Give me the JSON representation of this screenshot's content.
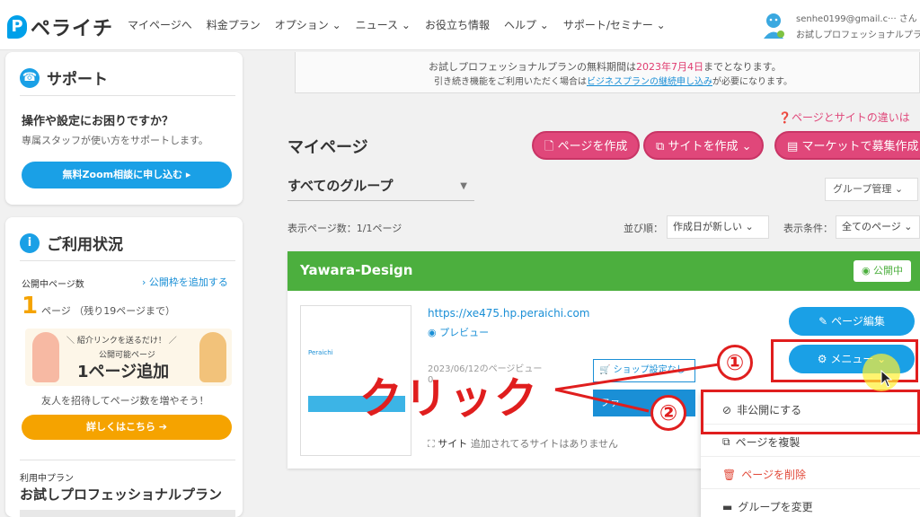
{
  "header": {
    "logo_text": "ペライチ",
    "nav": [
      "マイページへ",
      "料金プラン",
      "オプション ⌄",
      "ニュース ⌄",
      "お役立ち情報",
      "ヘルプ ⌄",
      "サポート/セミナー ⌄"
    ],
    "user_email": "senhe0199@gmail.c··· さん",
    "user_plan": "お試しプロフェッショナルプラン"
  },
  "sidebar": {
    "support": {
      "title": "サポート",
      "question": "操作や設定にお困りですか？",
      "description": "専属スタッフが使い方をサポートします。",
      "button": "無料Zoom相談に申し込む ▸"
    },
    "usage": {
      "title": "ご利用状況",
      "published_label": "公開中ページ数",
      "add_slot_link": "› 公開枠を追加する",
      "published_count": "1",
      "published_count_text": "ページ （残り19ページまで）",
      "promo_top": "＼ 紹介リンクを送るだけ！ ／",
      "promo_mid": "公開可能ページ",
      "promo_big": "1ページ追加",
      "invite_text": "友人を招待してページ数を増やそう！",
      "details_button": "詳しくはこちら ➔",
      "plan_label": "利用中プラン",
      "plan_name": "お試しプロフェッショナルプラン"
    }
  },
  "notice": {
    "line1_a": "お試しプロフェッショナルプランの無料期間は",
    "line1_em": "2023年7月4日",
    "line1_b": "までとなります。",
    "line2_a": "引き続き機能をご利用いただく場合は",
    "line2_link": "ビジネスプランの継続申し込み",
    "line2_b": "が必要になります。"
  },
  "main": {
    "diff_link": "❓ページとサイトの違いは",
    "title": "マイページ",
    "create_page": "ページを作成",
    "create_site": "サイトを作成 ⌄",
    "market_recruit": "マーケットで募集作成",
    "group_select": "すべてのグループ",
    "group_manage": "グループ管理 ⌄",
    "page_count": "表示ページ数：1/1ページ",
    "sort_label": "並び順：",
    "sort_value": "作成日が新しい ⌄",
    "cond_label": "表示条件：",
    "cond_value": "全てのページ ⌄"
  },
  "site_card": {
    "name": "Yawara-Design",
    "status": "公開中",
    "thumb_logo": "Peraichi",
    "url": "https://xe475.hp.peraichi.com",
    "preview": "プレビュー",
    "visits_label": "2023/06/12のページビュー",
    "visits_value": "0",
    "shop_button": "ショップ設定なし",
    "blue_button": "ファ",
    "sites_label": "サイト",
    "sites_value": "追加されてるサイトはありません",
    "edit_button": "ページ編集",
    "menu_button": "メニュー ⌄"
  },
  "dropdown": {
    "items": [
      "非公開にする",
      "ページを複製",
      "ページを削除",
      "グループを変更"
    ]
  },
  "annotations": {
    "step1": "①",
    "step2": "②",
    "click_text": "クリック"
  },
  "colors": {
    "accent_pink": "#e0477a",
    "accent_blue": "#1aa0e6",
    "header_green": "#4caf3e",
    "annotation_red": "#e01e1e"
  }
}
